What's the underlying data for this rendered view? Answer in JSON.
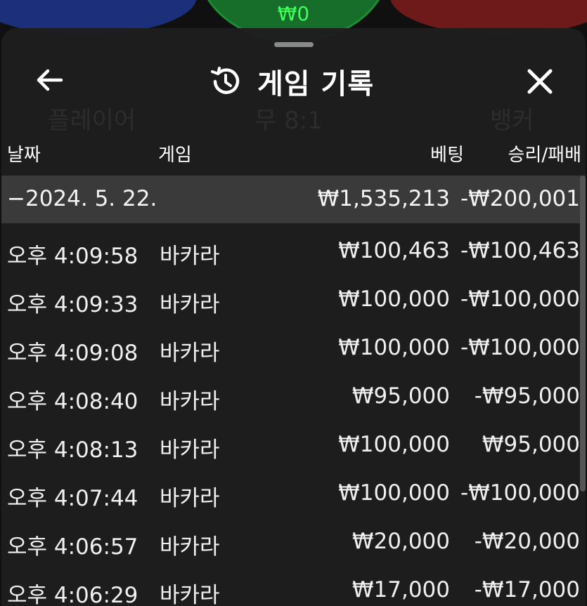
{
  "background": {
    "tie_amount": "₩0",
    "faint_labels": [
      "플레이어",
      "무 8:1",
      "뱅커"
    ]
  },
  "header": {
    "title": "게임 기록",
    "back_icon": "arrow-left-icon",
    "history_icon": "history-clock-icon",
    "close_icon": "close-icon"
  },
  "columns": {
    "date": "날짜",
    "game": "게임",
    "bet": "베팅",
    "result": "승리/패배"
  },
  "day_summary": {
    "date": "−2024. 5. 22.",
    "bet": "₩1,535,213",
    "result": "-₩200,001"
  },
  "rows": [
    {
      "time": "오후 4:09:58",
      "game": "바카라",
      "bet": "₩100,463",
      "result": "-₩100,463"
    },
    {
      "time": "오후 4:09:33",
      "game": "바카라",
      "bet": "₩100,000",
      "result": "-₩100,000"
    },
    {
      "time": "오후 4:09:08",
      "game": "바카라",
      "bet": "₩100,000",
      "result": "-₩100,000"
    },
    {
      "time": "오후 4:08:40",
      "game": "바카라",
      "bet": "₩95,000",
      "result": "-₩95,000"
    },
    {
      "time": "오후 4:08:13",
      "game": "바카라",
      "bet": "₩100,000",
      "result": "₩95,000"
    },
    {
      "time": "오후 4:07:44",
      "game": "바카라",
      "bet": "₩100,000",
      "result": "-₩100,000"
    },
    {
      "time": "오후 4:06:57",
      "game": "바카라",
      "bet": "₩20,000",
      "result": "-₩20,000"
    },
    {
      "time": "오후 4:06:29",
      "game": "바카라",
      "bet": "₩17,000",
      "result": "-₩17,000"
    }
  ]
}
